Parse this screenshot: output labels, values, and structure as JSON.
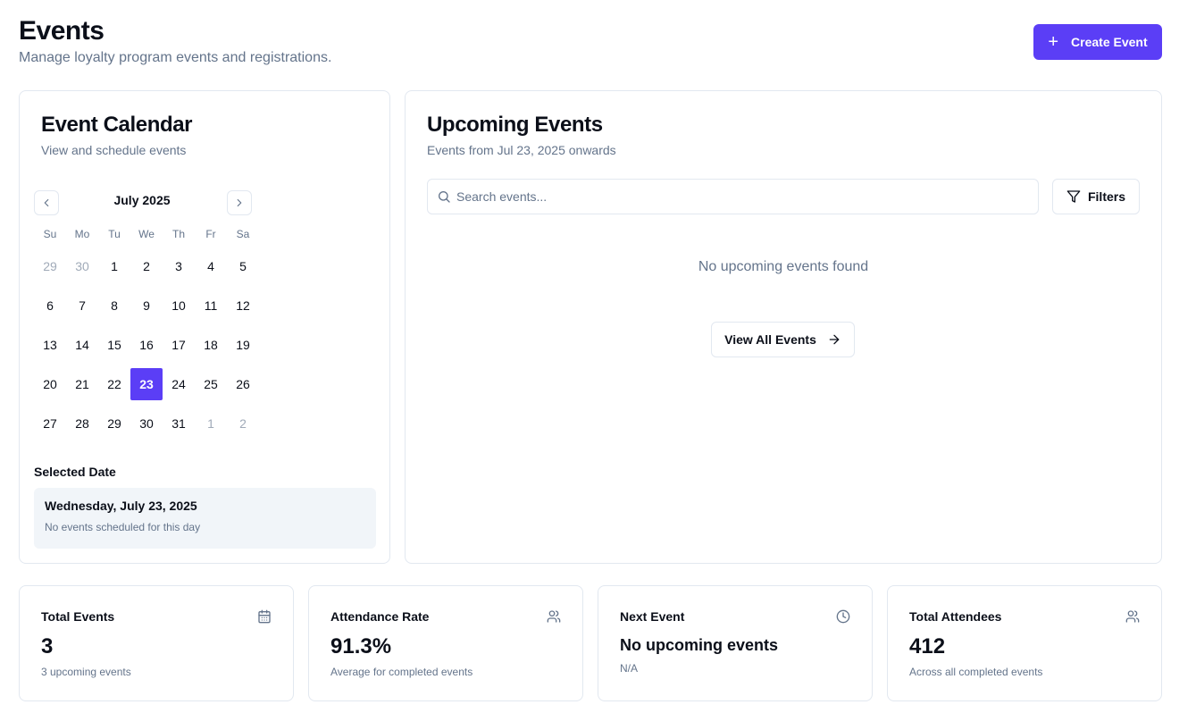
{
  "header": {
    "title": "Events",
    "subtitle": "Manage loyalty program events and registrations.",
    "create_button": "Create Event"
  },
  "calendar": {
    "title": "Event Calendar",
    "subtitle": "View and schedule events",
    "month_label": "July 2025",
    "weekdays": [
      "Su",
      "Mo",
      "Tu",
      "We",
      "Th",
      "Fr",
      "Sa"
    ],
    "weeks": [
      [
        {
          "d": "29",
          "muted": true
        },
        {
          "d": "30",
          "muted": true
        },
        {
          "d": "1"
        },
        {
          "d": "2"
        },
        {
          "d": "3"
        },
        {
          "d": "4"
        },
        {
          "d": "5"
        }
      ],
      [
        {
          "d": "6"
        },
        {
          "d": "7"
        },
        {
          "d": "8"
        },
        {
          "d": "9"
        },
        {
          "d": "10"
        },
        {
          "d": "11"
        },
        {
          "d": "12"
        }
      ],
      [
        {
          "d": "13"
        },
        {
          "d": "14"
        },
        {
          "d": "15"
        },
        {
          "d": "16"
        },
        {
          "d": "17"
        },
        {
          "d": "18"
        },
        {
          "d": "19"
        }
      ],
      [
        {
          "d": "20"
        },
        {
          "d": "21"
        },
        {
          "d": "22"
        },
        {
          "d": "23",
          "selected": true
        },
        {
          "d": "24"
        },
        {
          "d": "25"
        },
        {
          "d": "26"
        }
      ],
      [
        {
          "d": "27"
        },
        {
          "d": "28"
        },
        {
          "d": "29"
        },
        {
          "d": "30"
        },
        {
          "d": "31"
        },
        {
          "d": "1",
          "muted": true
        },
        {
          "d": "2",
          "muted": true
        }
      ]
    ],
    "selected_label": "Selected Date",
    "selected_date": "Wednesday, July 23, 2025",
    "selected_note": "No events scheduled for this day"
  },
  "upcoming": {
    "title": "Upcoming Events",
    "subtitle": "Events from Jul 23, 2025 onwards",
    "search_placeholder": "Search events...",
    "filters_label": "Filters",
    "empty_text": "No upcoming events found",
    "view_all_label": "View All Events"
  },
  "stats": {
    "total_events": {
      "label": "Total Events",
      "value": "3",
      "note": "3 upcoming events",
      "icon": "calendar-icon"
    },
    "attendance": {
      "label": "Attendance Rate",
      "value": "91.3%",
      "note": "Average for completed events",
      "icon": "users-icon"
    },
    "next_event": {
      "label": "Next Event",
      "value": "No upcoming events",
      "note": "N/A",
      "icon": "clock-icon"
    },
    "attendees": {
      "label": "Total Attendees",
      "value": "412",
      "note": "Across all completed events",
      "icon": "users-icon"
    }
  },
  "colors": {
    "accent": "#5b3ef6",
    "muted_text": "#64748b",
    "border": "#e2e8f0",
    "panel_bg": "#f1f5f9"
  }
}
